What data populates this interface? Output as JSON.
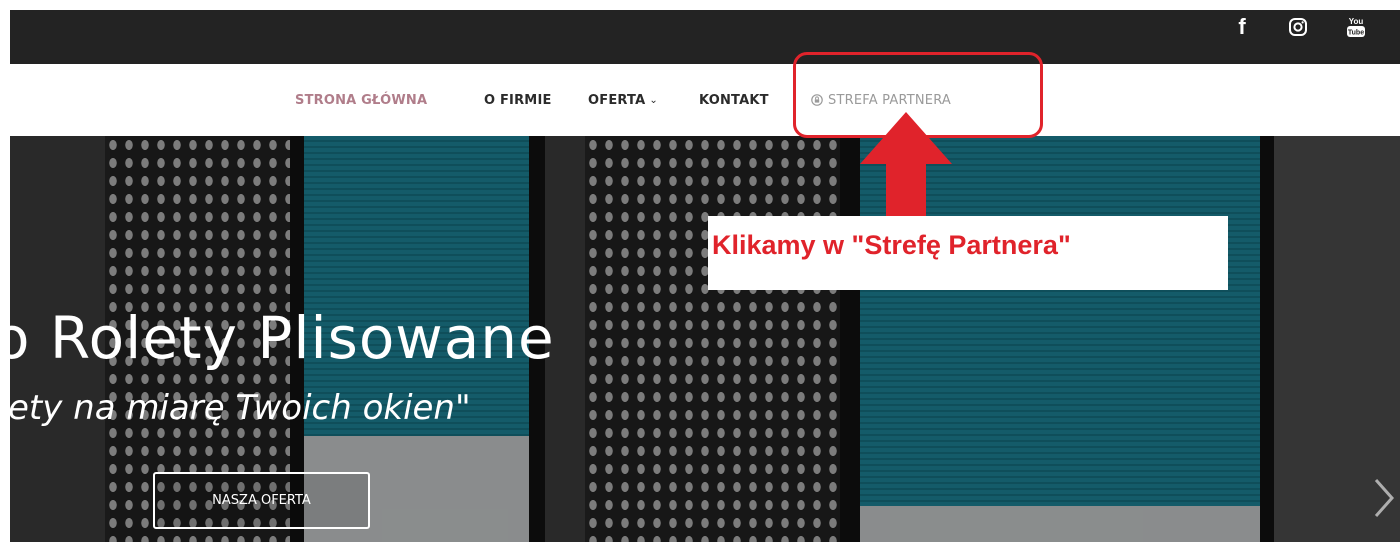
{
  "social": {
    "icons": [
      "facebook-icon",
      "instagram-icon",
      "youtube-icon"
    ],
    "facebook_glyph": "f",
    "youtube_top": "You",
    "youtube_bottom": "Tube"
  },
  "nav": {
    "items": [
      {
        "label": "STRONA GŁÓWNA",
        "active": true
      },
      {
        "label": "O FIRMIE"
      },
      {
        "label": "OFERTA",
        "has_dropdown": true
      },
      {
        "label": "KONTAKT"
      },
      {
        "label": "STREFA PARTNERA",
        "icon": "lock-icon"
      }
    ],
    "dropdown_caret": "⌄"
  },
  "hero": {
    "title": "o Rolety Plisowane",
    "subtitle": "ety na miarę Twoich okien\"",
    "button_label": "NASZA OFERTA",
    "next_icon": "chevron-right-icon"
  },
  "annotation": {
    "text": "Klikamy w \"Strefę Partnera\""
  },
  "colors": {
    "topbar": "#232323",
    "nav_active": "#b07d8a",
    "nav_text": "#2b2b2b",
    "nav_partner": "#9a9a9a",
    "annotation_red": "#e0232b",
    "blind_teal": "#1c7f92"
  }
}
